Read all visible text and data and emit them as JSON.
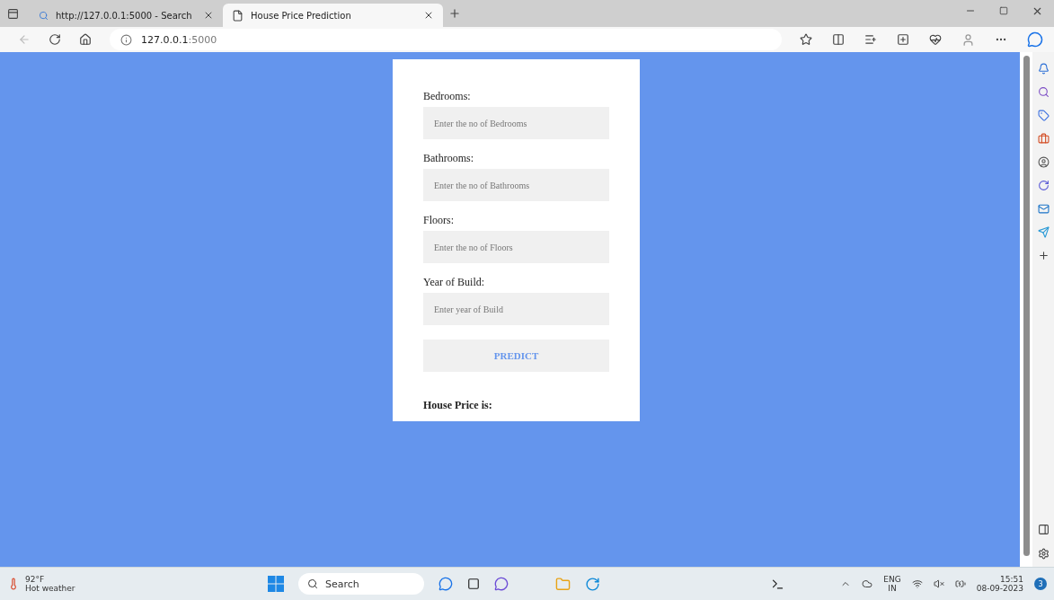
{
  "tabs": [
    {
      "label": "http://127.0.0.1:5000 - Search",
      "kind": "search",
      "selected": false
    },
    {
      "label": "House Price Prediction",
      "kind": "page",
      "selected": true
    }
  ],
  "address": {
    "host": "127.0.0.1",
    "port": ":5000"
  },
  "form": {
    "fields": [
      {
        "label": "Bedrooms:",
        "placeholder": "Enter the no of Bedrooms"
      },
      {
        "label": "Bathrooms:",
        "placeholder": "Enter the no of Bathrooms"
      },
      {
        "label": "Floors:",
        "placeholder": "Enter the no of Floors"
      },
      {
        "label": "Year of Build:",
        "placeholder": "Enter year of Build"
      }
    ],
    "button": "PREDICT",
    "result": "House Price is:"
  },
  "taskbar": {
    "temperature": "92°F",
    "weather": "Hot weather",
    "search_placeholder": "Search",
    "language": "ENG",
    "region": "IN",
    "time": "15:51",
    "date": "08-09-2023",
    "notifications": "3"
  }
}
